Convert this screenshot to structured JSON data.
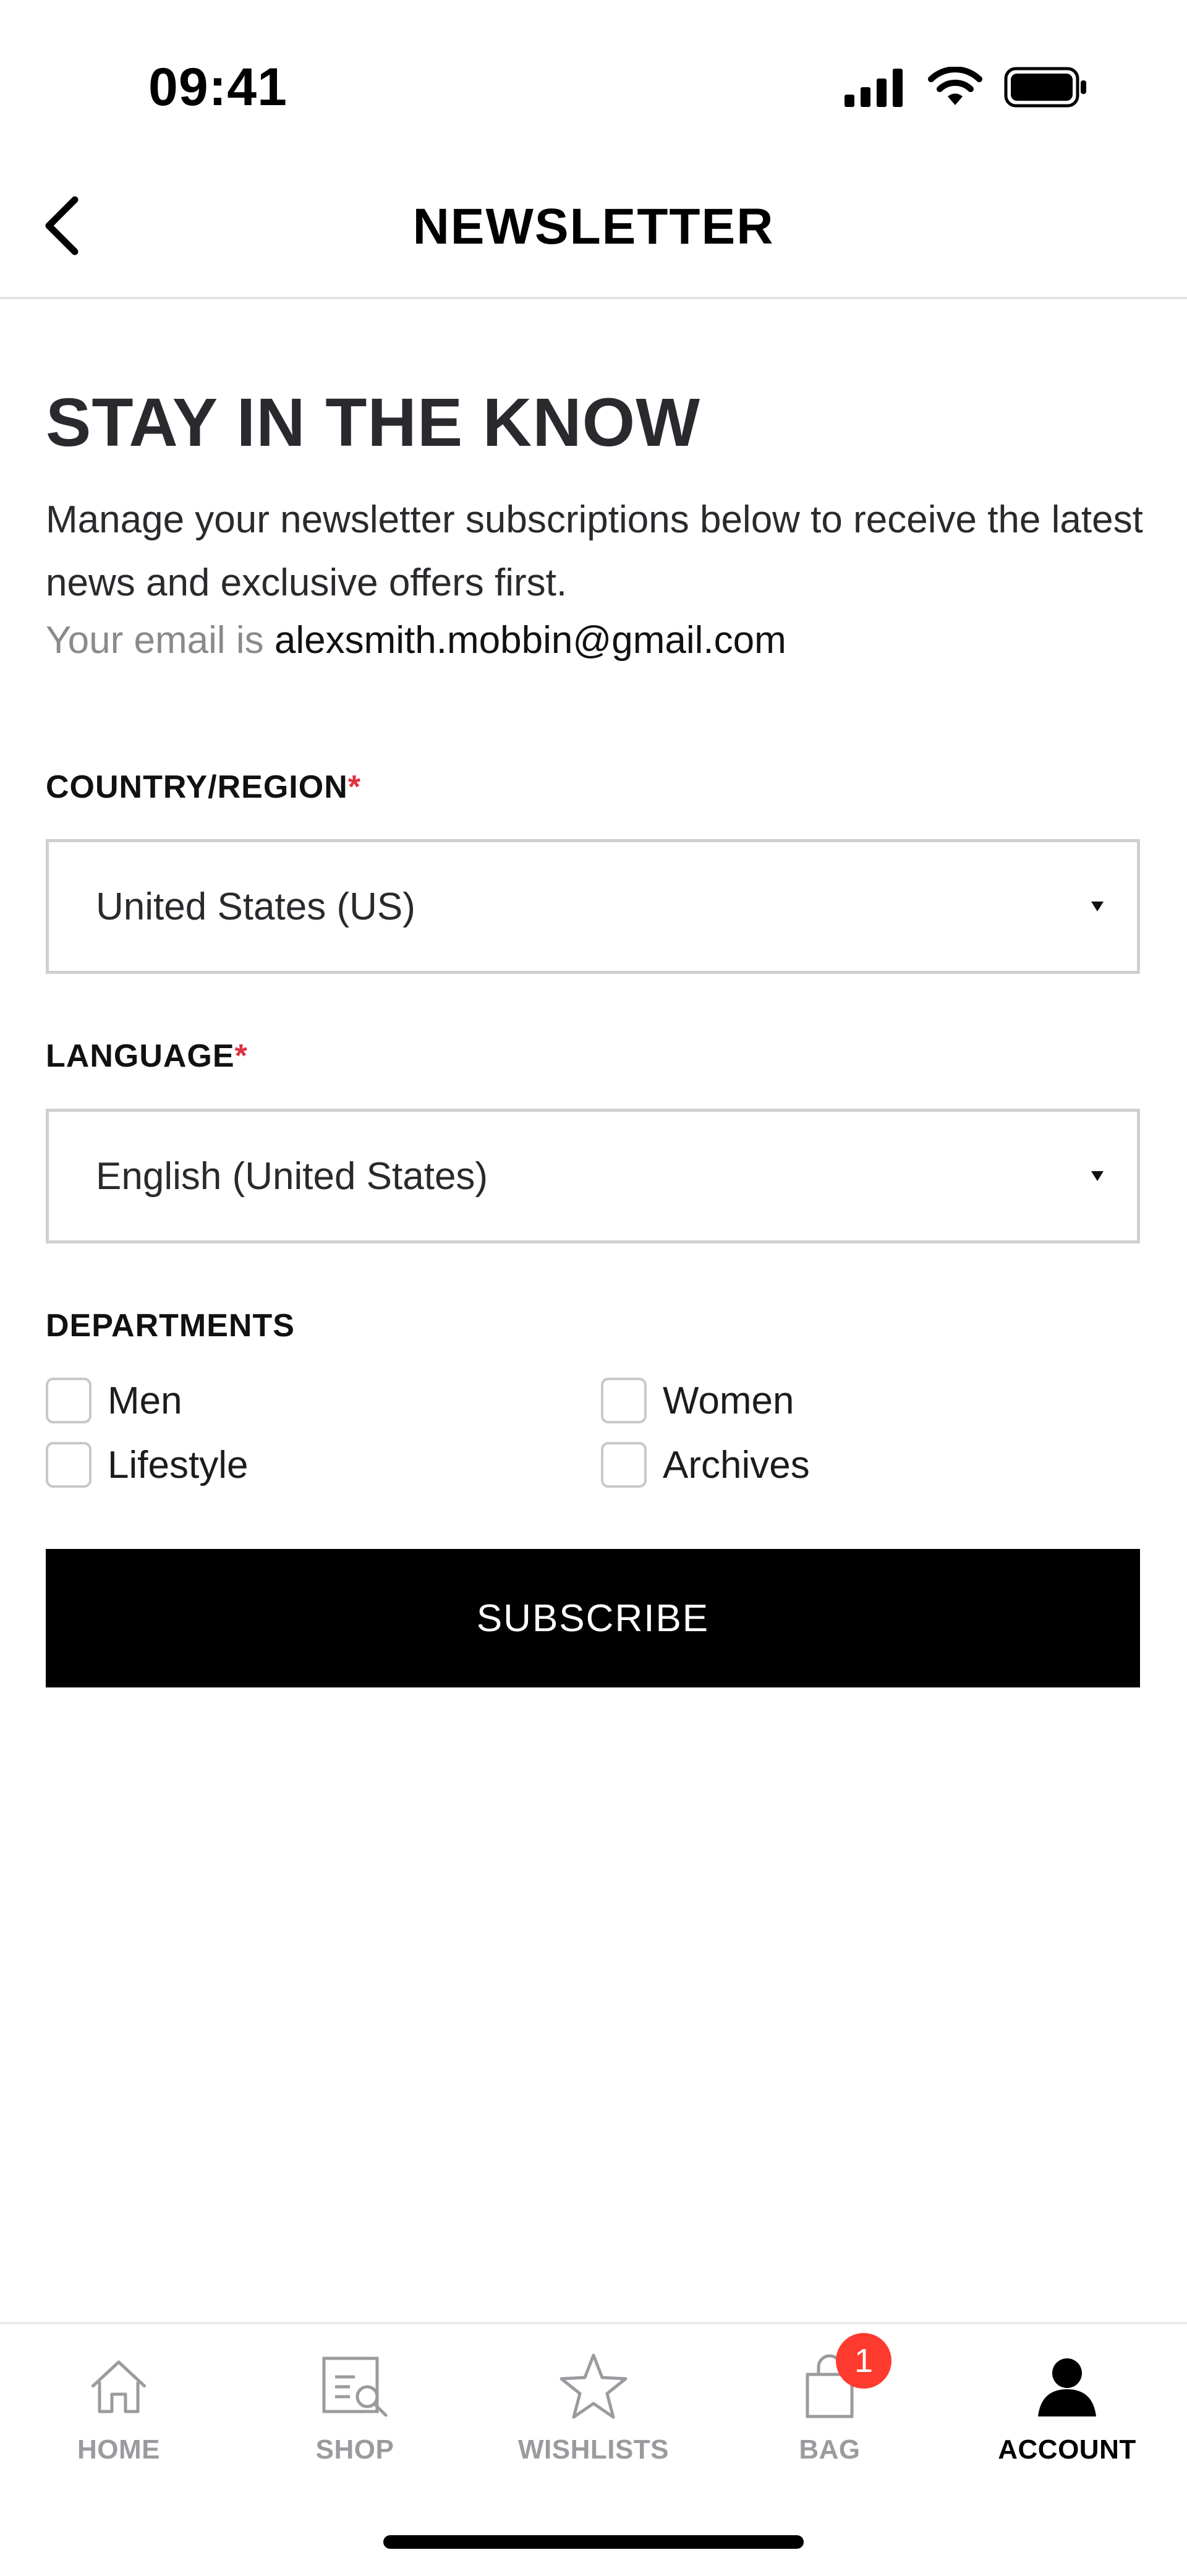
{
  "status_bar": {
    "time": "09:41"
  },
  "header": {
    "title": "NEWSLETTER"
  },
  "hero": {
    "title": "STAY IN THE KNOW",
    "description": "Manage your newsletter subscriptions below to receive the latest news and exclusive offers first.",
    "email_prefix": "Your email is ",
    "email": "alexsmith.mobbin@gmail.com"
  },
  "form": {
    "country_label": "COUNTRY/REGION",
    "country_value": "United States (US)",
    "language_label": "LANGUAGE",
    "language_value": "English (United States)",
    "required_mark": "*",
    "departments_label": "DEPARTMENTS",
    "departments": [
      "Men",
      "Women",
      "Lifestyle",
      "Archives"
    ],
    "subscribe_label": "SUBSCRIBE"
  },
  "tabbar": {
    "items": [
      {
        "label": "HOME",
        "icon": "home-icon"
      },
      {
        "label": "SHOP",
        "icon": "shop-search-icon"
      },
      {
        "label": "WISHLISTS",
        "icon": "star-icon"
      },
      {
        "label": "BAG",
        "icon": "bag-icon",
        "badge": "1"
      },
      {
        "label": "ACCOUNT",
        "icon": "person-icon",
        "active": true
      }
    ]
  },
  "colors": {
    "required": "#e0313f",
    "badge": "#ff3b30",
    "button_bg": "#000000",
    "tab_inactive": "#9b9b9f"
  }
}
